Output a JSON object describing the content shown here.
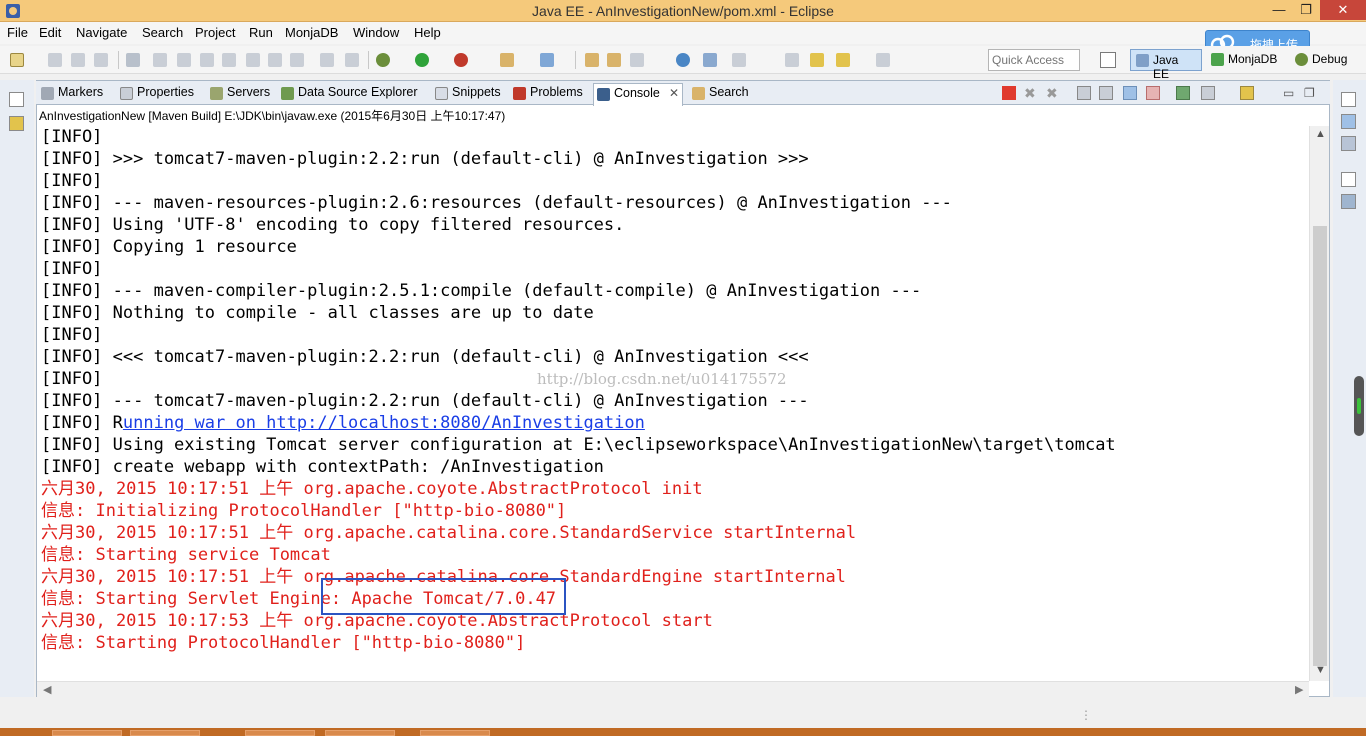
{
  "window": {
    "title": "Java EE - AnInvestigationNew/pom.xml - Eclipse",
    "minimize": "—",
    "maximize": "❐",
    "close": "✕"
  },
  "menu": [
    "File",
    "Edit",
    "Navigate",
    "Search",
    "Project",
    "Run",
    "MonjaDB",
    "Window",
    "Help"
  ],
  "upload_badge": {
    "label": "拖拽上传",
    "icon": "cloud-icon",
    "color": "#5aa0e6"
  },
  "toolbar": {
    "quick_access_placeholder": "Quick Access",
    "perspectives": [
      {
        "label": "Java EE",
        "active": true
      },
      {
        "label": "MonjaDB",
        "active": false
      },
      {
        "label": "Debug",
        "active": false
      }
    ]
  },
  "view_tabs": [
    {
      "label": "Markers",
      "icon": "markers-icon"
    },
    {
      "label": "Properties",
      "icon": "properties-icon"
    },
    {
      "label": "Servers",
      "icon": "servers-icon"
    },
    {
      "label": "Data Source Explorer",
      "icon": "data-source-icon"
    },
    {
      "label": "Snippets",
      "icon": "snippets-icon"
    },
    {
      "label": "Problems",
      "icon": "problems-icon"
    },
    {
      "label": "Console",
      "icon": "console-icon",
      "active": true
    },
    {
      "label": "Search",
      "icon": "search-icon"
    }
  ],
  "console": {
    "description": "AnInvestigationNew [Maven Build] E:\\JDK\\bin\\javaw.exe (2015年6月30日 上午10:17:47)",
    "lines": [
      {
        "text": "[INFO]",
        "style": "info"
      },
      {
        "text": "[INFO] >>> tomcat7-maven-plugin:2.2:run (default-cli) @ AnInvestigation >>>",
        "style": "info"
      },
      {
        "text": "[INFO]",
        "style": "info"
      },
      {
        "text": "[INFO] --- maven-resources-plugin:2.6:resources (default-resources) @ AnInvestigation ---",
        "style": "info"
      },
      {
        "text": "[INFO] Using 'UTF-8' encoding to copy filtered resources.",
        "style": "info"
      },
      {
        "text": "[INFO] Copying 1 resource",
        "style": "info"
      },
      {
        "text": "[INFO]",
        "style": "info"
      },
      {
        "text": "[INFO] --- maven-compiler-plugin:2.5.1:compile (default-compile) @ AnInvestigation ---",
        "style": "info"
      },
      {
        "text": "[INFO] Nothing to compile - all classes are up to date",
        "style": "info"
      },
      {
        "text": "[INFO]",
        "style": "info"
      },
      {
        "text": "[INFO] <<< tomcat7-maven-plugin:2.2:run (default-cli) @ AnInvestigation <<<",
        "style": "info"
      },
      {
        "text": "[INFO]",
        "style": "info"
      },
      {
        "text": "[INFO] --- tomcat7-maven-plugin:2.2:run (default-cli) @ AnInvestigation ---",
        "style": "info"
      },
      {
        "text": "[INFO] R",
        "style": "info",
        "link": "unning war on http://localhost:8080/AnInvestigation"
      },
      {
        "text": "[INFO] Using existing Tomcat server configuration at E:\\eclipseworkspace\\AnInvestigationNew\\target\\tomcat",
        "style": "info"
      },
      {
        "text": "[INFO] create webapp with contextPath: /AnInvestigation",
        "style": "info"
      },
      {
        "text": "六月30, 2015 10:17:51 上午 org.apache.coyote.AbstractProtocol init",
        "style": "err"
      },
      {
        "text": "信息: Initializing ProtocolHandler [\"http-bio-8080\"]",
        "style": "err"
      },
      {
        "text": "六月30, 2015 10:17:51 上午 org.apache.catalina.core.StandardService startInternal",
        "style": "err"
      },
      {
        "text": "信息: Starting service Tomcat",
        "style": "err"
      },
      {
        "text": "六月30, 2015 10:17:51 上午 org.apache.catalina.core.StandardEngine startInternal",
        "style": "err"
      },
      {
        "text": "信息: Starting Servlet Engine: Apache Tomcat/7.0.47",
        "style": "err"
      },
      {
        "text": "六月30, 2015 10:17:53 上午 org.apache.coyote.AbstractProtocol start",
        "style": "err"
      },
      {
        "text": "信息: Starting ProtocolHandler [\"http-bio-8080\"]",
        "style": "err"
      }
    ],
    "watermark": "http://blog.csdn.net/u014175572"
  },
  "colors": {
    "info": "#000000",
    "err": "#e0201b",
    "link": "#1a3ee6",
    "highlight": "#2b54c2",
    "titlebar": "#f5c97b"
  }
}
